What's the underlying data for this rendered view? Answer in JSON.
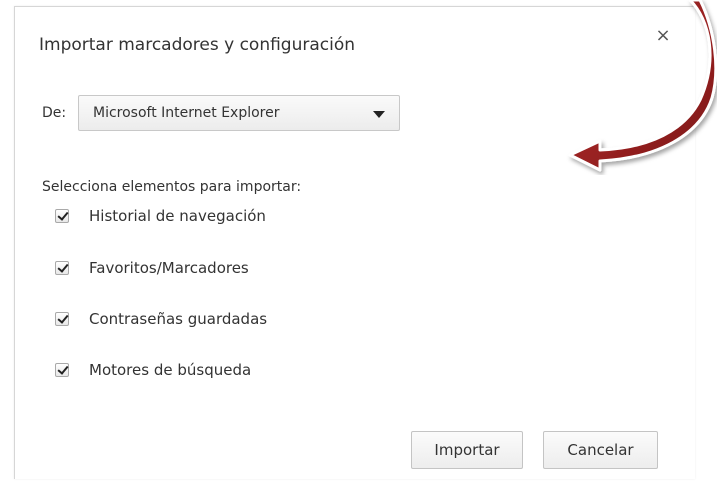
{
  "dialog": {
    "title": "Importar marcadores y configuración",
    "close_label": "×"
  },
  "source": {
    "label": "De:",
    "selected": "Microsoft Internet Explorer"
  },
  "items_section": {
    "label": "Selecciona elementos para importar:",
    "items": [
      {
        "label": "Historial de navegación",
        "checked": true
      },
      {
        "label": "Favoritos/Marcadores",
        "checked": true
      },
      {
        "label": "Contraseñas guardadas",
        "checked": true
      },
      {
        "label": "Motores de búsqueda",
        "checked": true
      }
    ]
  },
  "buttons": {
    "import_label": "Importar",
    "cancel_label": "Cancelar"
  },
  "colors": {
    "arrow_red": "#8a1c1c",
    "arrow_outline": "#ffffff"
  },
  "icons": {
    "close": "close-icon",
    "dropdown": "chevron-down-icon",
    "check": "checkmark-icon",
    "annotation": "curved-arrow-icon"
  }
}
